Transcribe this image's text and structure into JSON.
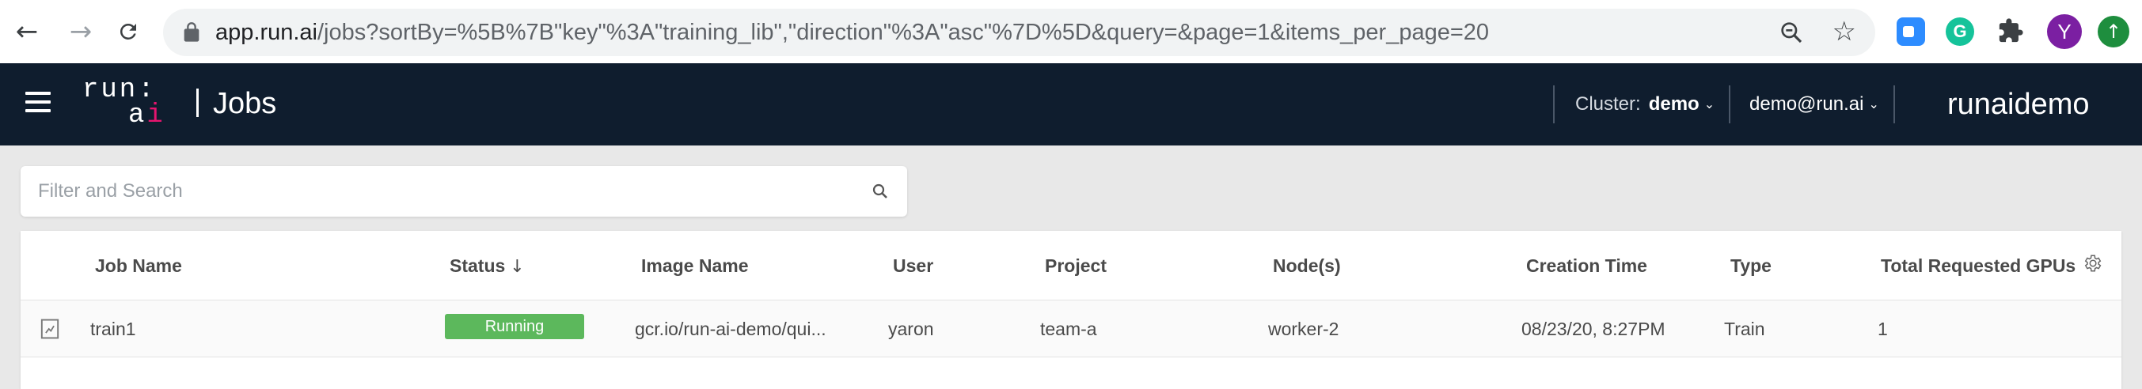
{
  "browser": {
    "url_host": "app.run.ai",
    "url_path": "/jobs?sortBy=%5B%7B\"key\"%3A\"training_lib\",\"direction\"%3A\"asc\"%7D%5D&query=&page=1&items_per_page=20",
    "profile_initial": "Y",
    "grammarly_letter": "G"
  },
  "header": {
    "logo_top": "run:",
    "logo_bottom_a": "a",
    "logo_bottom_i": "i",
    "page_title": "Jobs",
    "cluster_label": "Cluster:",
    "cluster_value": "demo",
    "user_email": "demo@run.ai",
    "tenant_name": "runaidemo"
  },
  "search": {
    "placeholder": "Filter and Search"
  },
  "table": {
    "columns": {
      "job_name": "Job Name",
      "status": "Status",
      "image_name": "Image Name",
      "user": "User",
      "project": "Project",
      "nodes": "Node(s)",
      "creation_time": "Creation Time",
      "type": "Type",
      "total_gpus": "Total Requested GPUs"
    },
    "rows": [
      {
        "job_name": "train1",
        "status": "Running",
        "image_name": "gcr.io/run-ai-demo/qui...",
        "user": "yaron",
        "project": "team-a",
        "nodes": "worker-2",
        "creation_time": "08/23/20, 8:27PM",
        "type": "Train",
        "total_gpus": "1"
      }
    ]
  },
  "colors": {
    "appbar": "#0f1d2e",
    "brand_accent": "#e5156e",
    "status_running": "#5cb85c"
  }
}
